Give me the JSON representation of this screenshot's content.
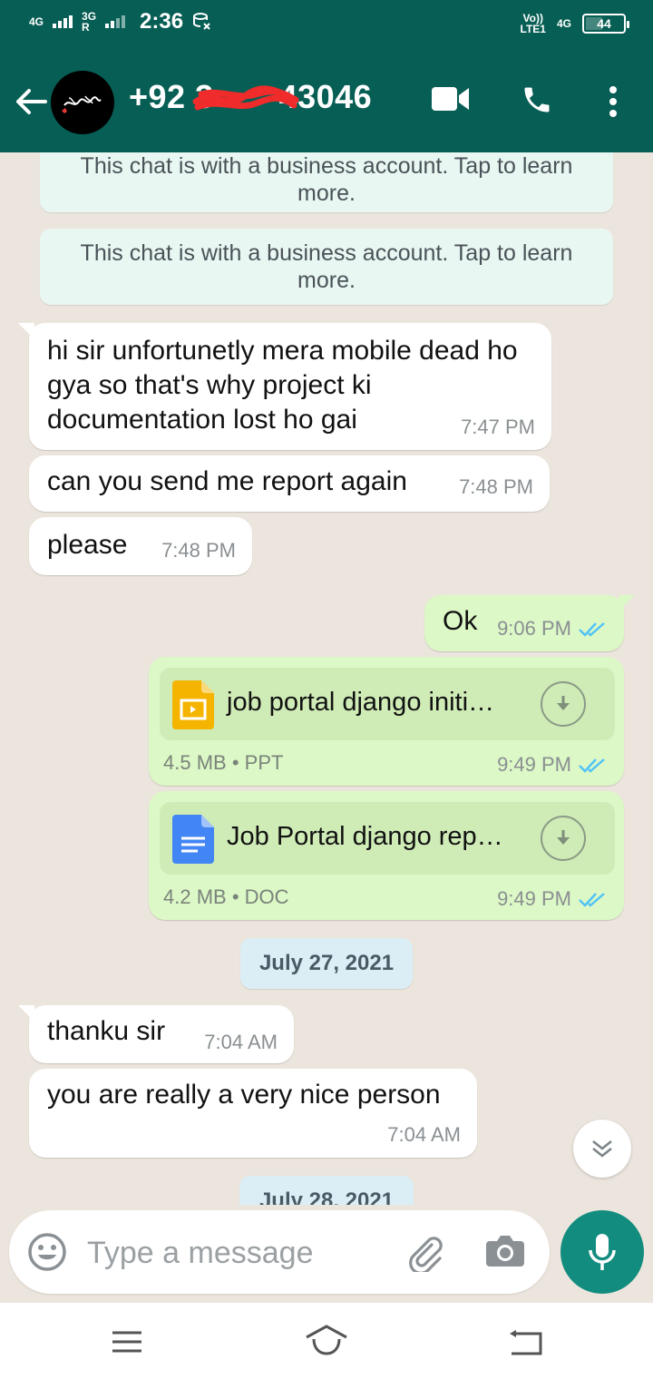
{
  "status_bar": {
    "net1": "4G",
    "net2": "3G",
    "net2_sub": "R",
    "time": "2:36",
    "volte_top": "Vo))",
    "volte_bottom": "LTE1",
    "net3": "4G",
    "battery": "44"
  },
  "header": {
    "phone_visible_start": "+92 3",
    "phone_visible_end": "43046",
    "phone_redacted": true,
    "actions": [
      "video-call-icon",
      "voice-call-icon",
      "more-vert-icon"
    ]
  },
  "system_notice": {
    "text": "This chat is with a business account. Tap to learn more."
  },
  "messages": [
    {
      "dir": "in",
      "text": "hi sir unfortunetly mera mobile dead ho gya so that's why project ki documentation lost ho gai",
      "time": "7:47 PM"
    },
    {
      "dir": "in",
      "text": "can you send me report again",
      "time": "7:48 PM"
    },
    {
      "dir": "in",
      "text": "please",
      "time": "7:48 PM"
    },
    {
      "dir": "out",
      "text": "Ok",
      "time": "9:06 PM"
    },
    {
      "dir": "out",
      "doc_name": "job portal django initi…",
      "doc_size": "4.5 MB",
      "doc_type": "PPT",
      "time": "9:49 PM",
      "icon": "slides-file-icon"
    },
    {
      "dir": "out",
      "doc_name": "Job Portal django rep…",
      "doc_size": "4.2 MB",
      "doc_type": "DOC",
      "time": "9:49 PM",
      "icon": "docs-file-icon"
    },
    {
      "dir": "in",
      "text": "thanku sir",
      "time": "7:04 AM"
    },
    {
      "dir": "in",
      "text": "you are really a very nice person",
      "time": "7:04 AM"
    }
  ],
  "date_separators": [
    "July 27, 2021",
    "July 28, 2021"
  ],
  "meta_separator": "•",
  "input": {
    "placeholder": "Type a message"
  },
  "colors": {
    "header": "#075e54",
    "outgoing_bubble": "#dcf8c6",
    "incoming_bubble": "#ffffff",
    "chat_bg": "#ece5dd",
    "read_tick": "#4fc3f7",
    "mic_button": "#128c7e"
  }
}
